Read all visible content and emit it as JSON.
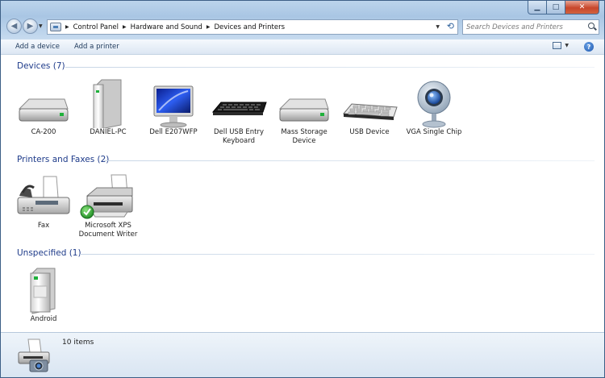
{
  "window": {
    "minimize_label": "▁",
    "maximize_label": "□",
    "close_label": "✕"
  },
  "nav": {
    "back_label": "◀",
    "forward_label": "▶",
    "dropdown_label": "▼"
  },
  "address": {
    "breadcrumbs": [
      "Control Panel",
      "Hardware and Sound",
      "Devices and Printers"
    ],
    "dropdown_label": "▼",
    "refresh_label": "⟲"
  },
  "search": {
    "placeholder": "Search Devices and Printers"
  },
  "toolbar": {
    "add_device_label": "Add a device",
    "add_printer_label": "Add a printer",
    "view_dropdown_label": "▼",
    "help_label": "?"
  },
  "groups": {
    "devices": {
      "title": "Devices (7)",
      "items": [
        {
          "label": "CA-200",
          "icon": "hard-drive-icon"
        },
        {
          "label": "DANIEL-PC",
          "icon": "tower-pc-icon"
        },
        {
          "label": "Dell E207WFP",
          "icon": "monitor-icon"
        },
        {
          "label": "Dell USB Entry Keyboard",
          "icon": "keyboard-icon"
        },
        {
          "label": "Mass Storage Device",
          "icon": "hard-drive-icon"
        },
        {
          "label": "USB Device",
          "icon": "keyboard-icon"
        },
        {
          "label": "VGA Single Chip",
          "icon": "webcam-icon"
        }
      ]
    },
    "printers": {
      "title": "Printers and Faxes (2)",
      "items": [
        {
          "label": "Fax",
          "icon": "fax-icon"
        },
        {
          "label": "Microsoft XPS Document Writer",
          "icon": "printer-icon",
          "default": true
        }
      ]
    },
    "unspecified": {
      "title": "Unspecified (1)",
      "items": [
        {
          "label": "Android",
          "icon": "generic-device-icon"
        }
      ]
    }
  },
  "details": {
    "count": "10 items"
  },
  "colors": {
    "group_header": "#1e3b8a",
    "frame": "#a9c6e4",
    "close": "#c7462b"
  }
}
